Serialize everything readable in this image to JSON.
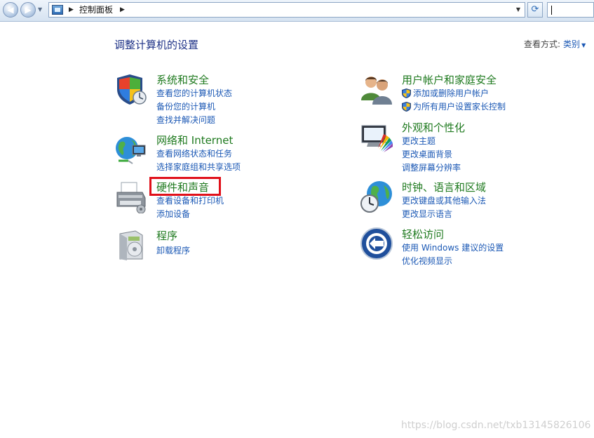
{
  "address_bar": {
    "breadcrumb": "控制面板",
    "search_value": ""
  },
  "page": {
    "title": "调整计算机的设置",
    "view_by_label": "查看方式:",
    "view_by_value": "类别"
  },
  "categories_left": [
    {
      "title": "系统和安全",
      "links": [
        "查看您的计算机状态",
        "备份您的计算机",
        "查找并解决问题"
      ]
    },
    {
      "title": "网络和 Internet",
      "links": [
        "查看网络状态和任务",
        "选择家庭组和共享选项"
      ]
    },
    {
      "title": "硬件和声音",
      "links": [
        "查看设备和打印机",
        "添加设备"
      ]
    },
    {
      "title": "程序",
      "links": [
        "卸载程序"
      ]
    }
  ],
  "categories_right": [
    {
      "title": "用户帐户和家庭安全",
      "links": [
        "添加或删除用户帐户",
        "为所有用户设置家长控制"
      ]
    },
    {
      "title": "外观和个性化",
      "links": [
        "更改主题",
        "更改桌面背景",
        "调整屏幕分辨率"
      ]
    },
    {
      "title": "时钟、语言和区域",
      "links": [
        "更改键盘或其他输入法",
        "更改显示语言"
      ]
    },
    {
      "title": "轻松访问",
      "links": [
        "使用 Windows 建议的设置",
        "优化视频显示"
      ]
    }
  ],
  "watermark": "https://blog.csdn.net/txb13145826106",
  "colors": {
    "title_text": "#1e3287",
    "category_title": "#1f7a1f",
    "link": "#1c59b5",
    "highlight_border": "#e0101a"
  },
  "icons": {
    "system_security": "shield-icon",
    "network": "globe-network-icon",
    "hardware_sound": "printer-icon",
    "programs": "programs-box-icon",
    "user_accounts": "users-icon",
    "appearance": "monitor-palette-icon",
    "clock_region": "globe-clock-icon",
    "ease_of_access": "ease-of-access-icon"
  }
}
